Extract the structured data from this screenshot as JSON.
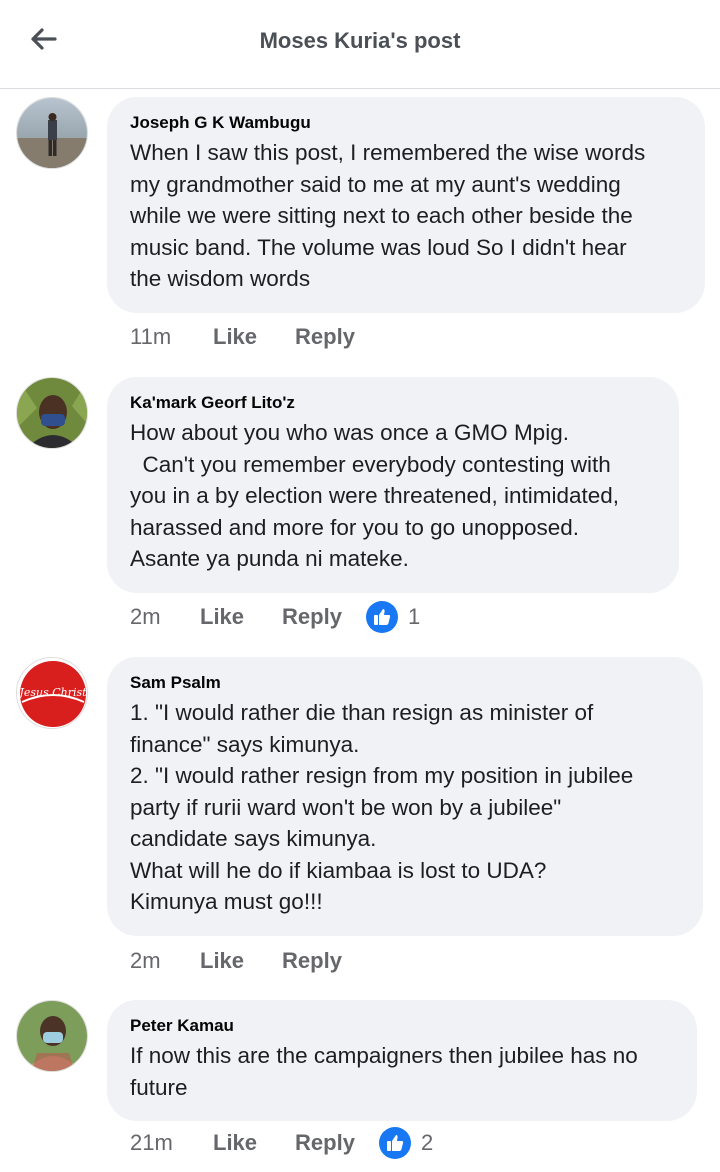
{
  "header": {
    "title": "Moses Kuria's post"
  },
  "comments": [
    {
      "author": "Joseph G K Wambugu",
      "text": "When I saw this post, I remembered the wise words\nmy grandmother said to me at my aunt's wedding\nwhile we were sitting next to each other beside the\nmusic band. The volume was loud So I didn't hear\nthe wisdom words",
      "time": "11m",
      "like_label": "Like",
      "reply_label": "Reply",
      "reaction_count": ""
    },
    {
      "author": "Ka'mark Georf Lito'z",
      "text": "How about you who was once a GMO Mpig.\n  Can't you remember everybody contesting with\nyou in a by election were threatened, intimidated,\nharassed and more for you to go unopposed.\nAsante ya punda ni mateke.",
      "time": "2m",
      "like_label": "Like",
      "reply_label": "Reply",
      "reaction_count": "1"
    },
    {
      "author": "Sam Psalm",
      "text": "1. \"I would rather die than resign as minister of\nfinance\" says kimunya.\n2. \"I would rather resign from my position in jubilee\nparty if rurii ward won't be won by a jubilee\"\ncandidate says kimunya.\nWhat will he do if kiambaa is lost to UDA?\nKimunya must go!!!",
      "time": "2m",
      "like_label": "Like",
      "reply_label": "Reply",
      "reaction_count": ""
    },
    {
      "author": "Peter Kamau",
      "text": "If now this are the campaigners then jubilee has no\nfuture",
      "time": "21m",
      "like_label": "Like",
      "reply_label": "Reply",
      "reaction_count": "2"
    }
  ],
  "avatars": {
    "jesus_logo_text": "Jesus Christ"
  },
  "colors": {
    "bubble": "#f0f2f5",
    "meta_text": "#65676b",
    "like_blue": "#1877f2"
  }
}
